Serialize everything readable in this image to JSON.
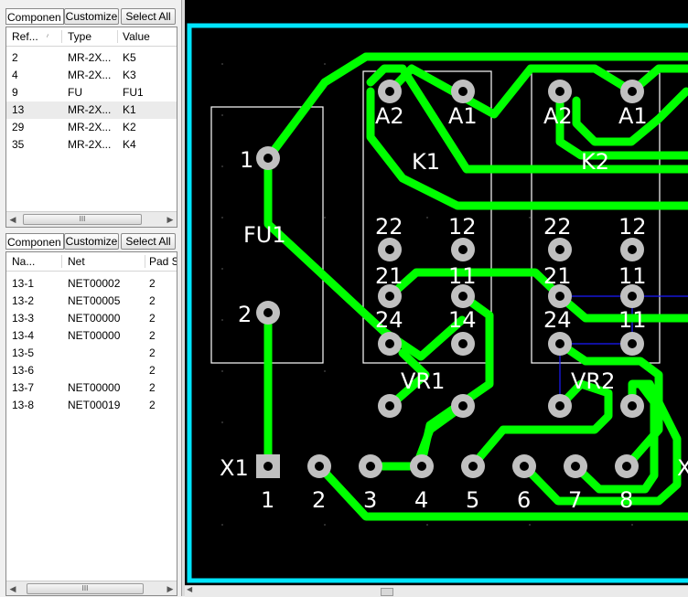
{
  "components_panel": {
    "title": "Componen",
    "customize_label": "Customize",
    "select_all_label": "Select All",
    "columns": [
      "Ref...",
      "Type",
      "Value"
    ],
    "rows": [
      {
        "ref": "2",
        "type": "MR-2X...",
        "value": "K5"
      },
      {
        "ref": "4",
        "type": "MR-2X...",
        "value": "K3"
      },
      {
        "ref": "9",
        "type": "FU",
        "value": "FU1"
      },
      {
        "ref": "13",
        "type": "MR-2X...",
        "value": "K1"
      },
      {
        "ref": "29",
        "type": "MR-2X...",
        "value": "K2"
      },
      {
        "ref": "35",
        "type": "MR-2X...",
        "value": "K4"
      }
    ],
    "selected_row": 3,
    "scroll_thumb": "III"
  },
  "pads_panel": {
    "title": "Componen",
    "customize_label": "Customize",
    "select_all_label": "Select All",
    "columns": [
      "Na...",
      "Net",
      "Pad S"
    ],
    "rows": [
      {
        "name": "13-1",
        "net": "NET00002",
        "pad": "2"
      },
      {
        "name": "13-2",
        "net": "NET00005",
        "pad": "2"
      },
      {
        "name": "13-3",
        "net": "NET00000",
        "pad": "2"
      },
      {
        "name": "13-4",
        "net": "NET00000",
        "pad": "2"
      },
      {
        "name": "13-5",
        "net": "",
        "pad": "2"
      },
      {
        "name": "13-6",
        "net": "",
        "pad": "2"
      },
      {
        "name": "13-7",
        "net": "NET00000",
        "pad": "2"
      },
      {
        "name": "13-8",
        "net": "NET00019",
        "pad": "2"
      }
    ],
    "scroll_thumb": "III"
  },
  "pcb": {
    "colors": {
      "board_outline": "#00e5ff",
      "trace": "#00ff00",
      "pad": "#c0c0c0",
      "silkscreen": "#ffffff",
      "ratsnest": "#1a1aff",
      "background": "#000000"
    },
    "fuse": {
      "label": "FU1",
      "pin_1": "1",
      "pin_2": "2"
    },
    "relay_k1": {
      "ref": "K1",
      "pins": [
        "A2",
        "A1",
        "22",
        "12",
        "21",
        "11",
        "24",
        "14"
      ]
    },
    "relay_k2": {
      "ref": "K2",
      "pins": [
        "A2",
        "A1",
        "22",
        "12",
        "21",
        "11",
        "24",
        "11"
      ]
    },
    "vr1": {
      "label": "VR1"
    },
    "vr2": {
      "label": "VR2"
    },
    "connector": {
      "ref": "X1",
      "pins": [
        "1",
        "2",
        "3",
        "4",
        "5",
        "6",
        "7",
        "8"
      ]
    },
    "cut_label": "X"
  }
}
